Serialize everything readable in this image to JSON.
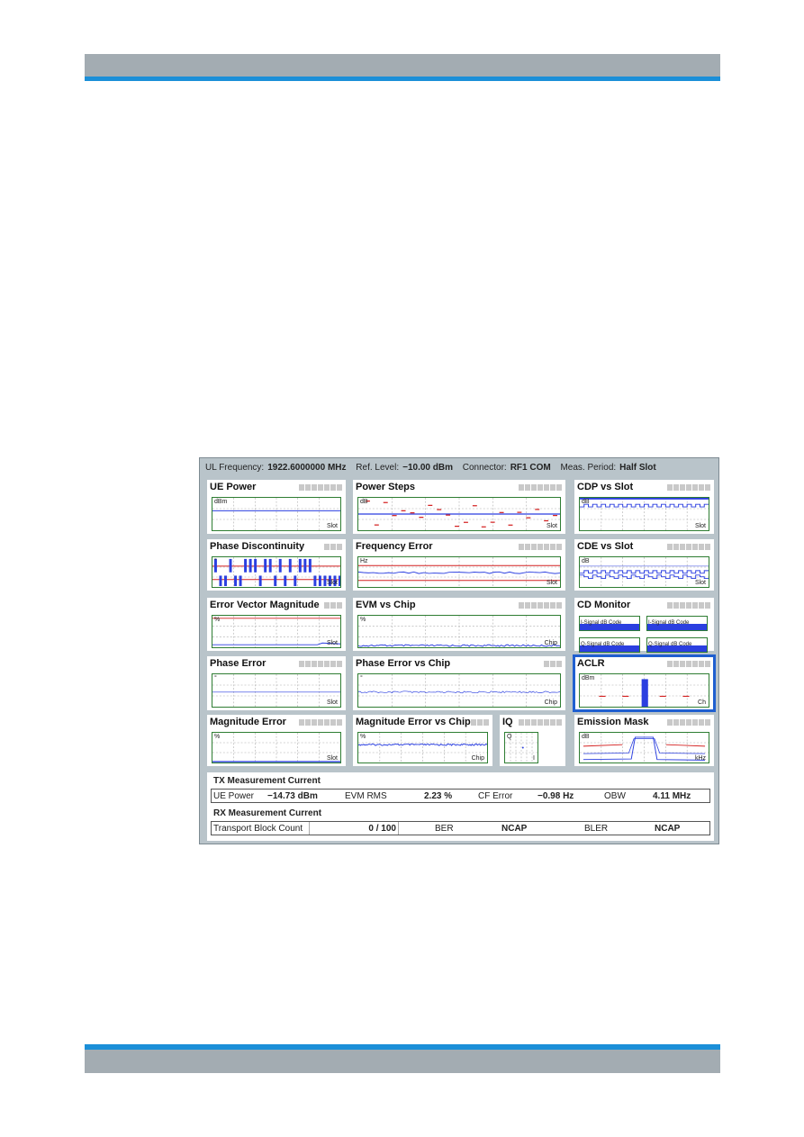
{
  "infobar": {
    "ul_frequency_label": "UL Frequency:",
    "ul_frequency_value": "1922.6000000 MHz",
    "ref_level_label": "Ref. Level:",
    "ref_level_value": "−10.00 dBm",
    "connector_label": "Connector:",
    "connector_value": "RF1 COM",
    "meas_period_label": "Meas. Period:",
    "meas_period_value": "Half Slot"
  },
  "panels": [
    {
      "title": "UE Power",
      "unit": "dBm",
      "xlabel": "Slot",
      "trace": "flat"
    },
    {
      "title": "Power Steps",
      "unit": "dB",
      "xlabel": "Slot",
      "trace": "steps"
    },
    {
      "title": "CDP vs Slot",
      "unit": "dB",
      "xlabel": "Slot",
      "trace": "square"
    },
    {
      "title": "Phase Discontinuity",
      "unit": "°",
      "xlabel": "Slot",
      "trace": "bars"
    },
    {
      "title": "Frequency Error",
      "unit": "Hz",
      "xlabel": "Slot",
      "trace": "freq"
    },
    {
      "title": "CDE vs Slot",
      "unit": "dB",
      "xlabel": "Slot",
      "trace": "square2"
    },
    {
      "title": "Error Vector Magnitude",
      "unit": "%",
      "xlabel": "Slot",
      "trace": "evm"
    },
    {
      "title": "EVM vs Chip",
      "unit": "%",
      "xlabel": "Chip",
      "trace": "noisebottom"
    },
    {
      "title": "CD Monitor",
      "unit": "",
      "xlabel": "",
      "trace": "cdm"
    },
    {
      "title": "Phase Error",
      "unit": "°",
      "xlabel": "Slot",
      "trace": "mid"
    },
    {
      "title": "Phase Error vs Chip",
      "unit": "°",
      "xlabel": "Chip",
      "trace": "noisemid"
    },
    {
      "title": "ACLR",
      "unit": "dBm",
      "xlabel": "Ch",
      "trace": "aclr"
    },
    {
      "title": "Magnitude Error",
      "unit": "%",
      "xlabel": "Slot",
      "trace": "bottom"
    },
    {
      "title": "Magnitude Error vs Chip",
      "unit": "%",
      "xlabel": "Chip",
      "trace": "noisehigh"
    },
    {
      "title": "IQ",
      "unit": "Q",
      "xlabel": "I",
      "trace": "iq"
    },
    {
      "title": "Emission Mask",
      "unit": "dB",
      "xlabel": "kHz",
      "trace": "mask"
    }
  ],
  "cd_monitor": [
    "I-Signal dB Code",
    "I-Signal dB Code",
    "Q-Signal dB Code",
    "Q-Signal dB Code"
  ],
  "tx": {
    "heading": "TX Measurement Current",
    "ue_power_label": "UE Power",
    "ue_power_value": "−14.73 dBm",
    "evm_rms_label": "EVM RMS",
    "evm_rms_value": "2.23 %",
    "cf_error_label": "CF Error",
    "cf_error_value": "−0.98 Hz",
    "obw_label": "OBW",
    "obw_value": "4.11 MHz"
  },
  "rx": {
    "heading": "RX Measurement Current",
    "tbc_label": "Transport Block Count",
    "tbc_value": "0 / 100",
    "ber_label": "BER",
    "ber_value": "NCAP",
    "bler_label": "BLER",
    "bler_value": "NCAP"
  },
  "colors": {
    "trace": "#2b3fe0",
    "limit": "#d42020",
    "plot_border": "#2e7d32",
    "accent": "#1b8fd8",
    "selected": "#1f5fd0"
  },
  "selected_panel": "ACLR"
}
